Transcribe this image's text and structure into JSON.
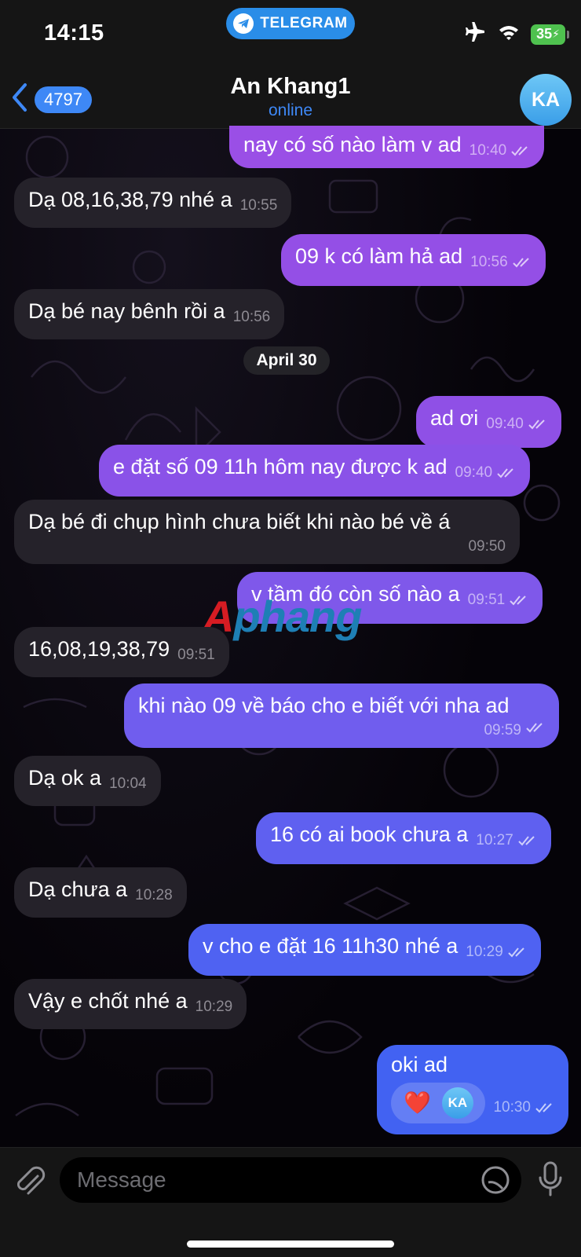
{
  "status_bar": {
    "time": "14:15",
    "pill_label": "TELEGRAM",
    "battery": "35"
  },
  "header": {
    "back_count": "4797",
    "title": "An Khang1",
    "status": "online",
    "avatar_initials": "KA"
  },
  "date_separator": "April 30",
  "watermark": {
    "part1": "A",
    "part2": "phang"
  },
  "messages": [
    {
      "dir": "out",
      "text": "nay có số nào làm v ad",
      "time": "10:40"
    },
    {
      "dir": "in",
      "text": "Dạ 08,16,38,79 nhé a",
      "time": "10:55"
    },
    {
      "dir": "out",
      "text": "09 k có làm hả ad",
      "time": "10:56"
    },
    {
      "dir": "in",
      "text": "Dạ bé nay bênh rồi a",
      "time": "10:56"
    },
    {
      "dir": "out",
      "text": "ad ơi",
      "time": "09:40"
    },
    {
      "dir": "out",
      "text": "e đặt số 09 11h hôm nay được k ad",
      "time": "09:40"
    },
    {
      "dir": "in",
      "text": "Dạ bé  đi chụp hình chưa biết khi nào bé về á",
      "time": "09:50"
    },
    {
      "dir": "out",
      "text": "v tầm đó còn số nào a",
      "time": "09:51"
    },
    {
      "dir": "in",
      "text": "16,08,19,38,79",
      "time": "09:51"
    },
    {
      "dir": "out",
      "text": "khi nào 09 về báo cho e biết với nha ad",
      "time": "09:59"
    },
    {
      "dir": "in",
      "text": "Dạ ok a",
      "time": "10:04"
    },
    {
      "dir": "out",
      "text": "16 có ai book chưa a",
      "time": "10:27"
    },
    {
      "dir": "in",
      "text": "Dạ chưa a",
      "time": "10:28"
    },
    {
      "dir": "out",
      "text": "v cho e đặt 16 11h30 nhé a",
      "time": "10:29"
    },
    {
      "dir": "in",
      "text": "Vậy e chốt nhé a",
      "time": "10:29"
    },
    {
      "dir": "out",
      "text": "oki ad",
      "time": "10:30",
      "reaction": "❤️",
      "reaction_avatar": "KA"
    }
  ],
  "input": {
    "placeholder": "Message"
  },
  "icons": [
    "back-chevron-icon",
    "telegram-plane-icon",
    "airplane-mode-icon",
    "wifi-icon",
    "battery-icon",
    "double-check-icon",
    "attach-icon",
    "sticker-icon",
    "microphone-icon"
  ],
  "colors": {
    "accent": "#3e88f6",
    "incoming_bubble": "#25222a",
    "outgoing_top": "#9b4ee6",
    "outgoing_bottom": "#3a60f2",
    "battery": "#4fc14f"
  }
}
